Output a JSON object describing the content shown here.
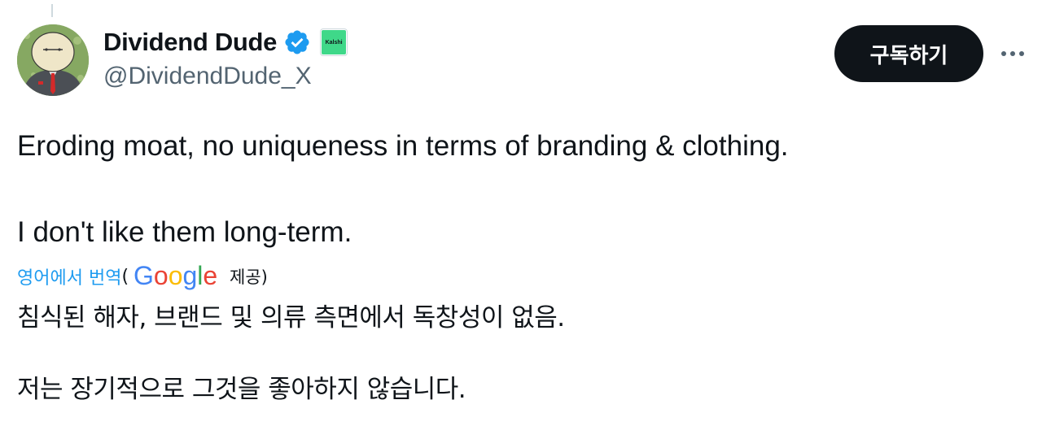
{
  "author": {
    "display_name": "Dividend Dude",
    "handle": "@DividendDude_X",
    "affiliate_badge_text": "Kalshi",
    "verified_icon": "verified-badge-icon",
    "verified_color": "#1d9bf0"
  },
  "actions": {
    "subscribe_label": "구독하기",
    "more_icon": "more-options-icon"
  },
  "tweet": {
    "lines": [
      "Eroding moat, no uniqueness in terms of branding & clothing.",
      "I don't like them long-term."
    ]
  },
  "translation": {
    "link_text": "영어에서 번역",
    "paren_open": "(",
    "provider_logo_text": "Google",
    "provided_text": "제공)",
    "lines": [
      "침식된 해자, 브랜드 및 의류 측면에서 독창성이 없음.",
      "저는 장기적으로 그것을 좋아하지 않습니다."
    ]
  },
  "colors": {
    "text_primary": "#0f1419",
    "text_secondary": "#536471",
    "link": "#1d9bf0",
    "subscribe_bg": "#0f1419",
    "affiliate_green": "#3fd889"
  }
}
